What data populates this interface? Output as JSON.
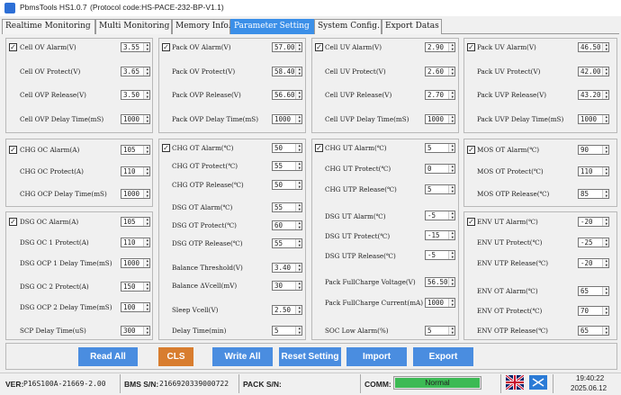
{
  "app": {
    "title": "PbmsTools HS1.0.7",
    "protocol": "(Protocol code:HS-PACE-232-BP-V1.1)"
  },
  "tabs": [
    {
      "label": "Realtime Monitoring",
      "active": false
    },
    {
      "label": "Multi Monitoring",
      "active": false
    },
    {
      "label": "Memory Info.",
      "active": false
    },
    {
      "label": "Parameter Setting",
      "active": true
    },
    {
      "label": "System Config.",
      "active": false
    },
    {
      "label": "Export Datas",
      "active": false
    }
  ],
  "panels": {
    "cell_ov": {
      "items": [
        {
          "label": "Cell OV Alarm(V)",
          "value": "3.55",
          "checkbox": true
        },
        {
          "label": "Cell OV Protect(V)",
          "value": "3.65"
        },
        {
          "label": "Cell OVP Release(V)",
          "value": "3.50"
        },
        {
          "label": "Cell OVP Delay Time(mS)",
          "value": "1000"
        }
      ]
    },
    "pack_ov": {
      "items": [
        {
          "label": "Pack OV Alarm(V)",
          "value": "57.00",
          "checkbox": true
        },
        {
          "label": "Pack OV Protect(V)",
          "value": "58.40"
        },
        {
          "label": "Pack OVP Release(V)",
          "value": "56.60"
        },
        {
          "label": "Pack OVP Delay Time(mS)",
          "value": "1000"
        }
      ]
    },
    "cell_uv": {
      "items": [
        {
          "label": "Cell UV Alarm(V)",
          "value": "2.90",
          "checkbox": true
        },
        {
          "label": "Cell UV Protect(V)",
          "value": "2.60"
        },
        {
          "label": "Cell UVP Release(V)",
          "value": "2.70"
        },
        {
          "label": "Cell UVP Delay Time(mS)",
          "value": "1000"
        }
      ]
    },
    "pack_uv": {
      "items": [
        {
          "label": "Pack UV Alarm(V)",
          "value": "46.50",
          "checkbox": true
        },
        {
          "label": "Pack UV Protect(V)",
          "value": "42.00"
        },
        {
          "label": "Pack UVP Release(V)",
          "value": "43.20"
        },
        {
          "label": "Pack UVP Delay Time(mS)",
          "value": "1000"
        }
      ]
    },
    "chg_oc": {
      "items": [
        {
          "label": "CHG OC Alarm(A)",
          "value": "105",
          "checkbox": true
        },
        {
          "label": "CHG OC Protect(A)",
          "value": "110"
        },
        {
          "label": "CHG OCP Delay Time(mS)",
          "value": "1000"
        }
      ]
    },
    "dsg_oc": {
      "items": [
        {
          "label": "DSG OC Alarm(A)",
          "value": "105",
          "checkbox": true
        },
        {
          "label": "DSG OC 1 Protect(A)",
          "value": "110"
        },
        {
          "label": "DSG OCP 1 Delay Time(mS)",
          "value": "1000"
        },
        {
          "label": "DSG OC 2 Protect(A)",
          "value": "150"
        },
        {
          "label": "DSG OCP 2 Delay Time(mS)",
          "value": "100"
        },
        {
          "label": "SCP Delay Time(uS)",
          "value": "300"
        }
      ]
    },
    "chg_ot": {
      "items": [
        {
          "label": "CHG OT Alarm(℃)",
          "value": "50",
          "checkbox": true
        },
        {
          "label": "CHG OT Protect(℃)",
          "value": "55"
        },
        {
          "label": "CHG OTP Release(℃)",
          "value": "50"
        },
        {
          "label": "DSG OT Alarm(℃)",
          "value": "55"
        },
        {
          "label": "DSG OT Protect(℃)",
          "value": "60"
        },
        {
          "label": "DSG OTP Release(℃)",
          "value": "55"
        },
        {
          "label": "Balance Threshold(V)",
          "value": "3.40"
        },
        {
          "label": "Balance ΔVcell(mV)",
          "value": "30"
        },
        {
          "label": "Sleep Vcell(V)",
          "value": "2.50"
        },
        {
          "label": "Delay Time(min)",
          "value": "5"
        }
      ]
    },
    "chg_ut": {
      "items": [
        {
          "label": "CHG UT Alarm(℃)",
          "value": "5",
          "checkbox": true
        },
        {
          "label": "CHG UT Protect(℃)",
          "value": "0"
        },
        {
          "label": "CHG UTP Release(℃)",
          "value": "5"
        },
        {
          "label": "DSG UT Alarm(℃)",
          "value": "-5"
        },
        {
          "label": "DSG UT Protect(℃)",
          "value": "-15"
        },
        {
          "label": "DSG UTP Release(℃)",
          "value": "-5"
        },
        {
          "label": "Pack FullCharge Voltage(V)",
          "value": "56.50"
        },
        {
          "label": "Pack FullCharge Current(mA)",
          "value": "1000"
        },
        {
          "label": "SOC Low Alarm(%)",
          "value": "5"
        }
      ]
    },
    "mos_ot": {
      "items": [
        {
          "label": "MOS OT Alarm(℃)",
          "value": "90",
          "checkbox": true
        },
        {
          "label": "MOS OT Protect(℃)",
          "value": "110"
        },
        {
          "label": "MOS OTP Release(℃)",
          "value": "85"
        }
      ]
    },
    "env": {
      "items": [
        {
          "label": "ENV UT Alarm(℃)",
          "value": "-20",
          "checkbox": true
        },
        {
          "label": "ENV UT Protect(℃)",
          "value": "-25"
        },
        {
          "label": "ENV UTP Release(℃)",
          "value": "-20"
        },
        {
          "label": "ENV OT Alarm(℃)",
          "value": "65"
        },
        {
          "label": "ENV OT Protect(℃)",
          "value": "70"
        },
        {
          "label": "ENV OTP Release(℃)",
          "value": "65"
        }
      ]
    }
  },
  "buttons": {
    "read_all": "Read All",
    "cls": "CLS",
    "write_all": "Write All",
    "reset": "Reset Setting",
    "import": "Import",
    "export": "Export"
  },
  "status": {
    "ver_label": "VER:",
    "ver_value": "P16S100A-21669-2.00",
    "bms_label": "BMS S/N:",
    "bms_value": "2166920339000722",
    "pack_label": "PACK S/N:",
    "pack_value": "",
    "comm_label": "COMM:",
    "comm_value": "Normal",
    "time": "19:40:22",
    "date": "2025.06.12"
  },
  "colors": {
    "accent": "#3b8fe8",
    "button": "#4a8de0",
    "cls": "#d87d2f",
    "comm_ok": "#3cba54"
  }
}
